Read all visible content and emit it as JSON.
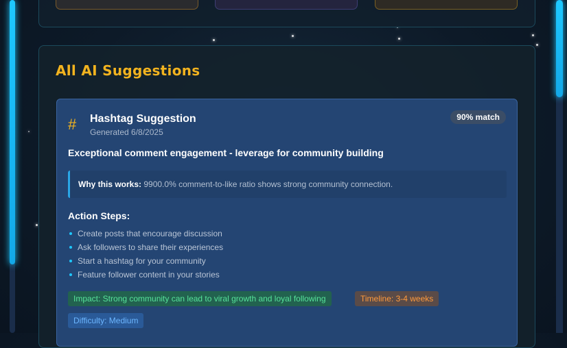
{
  "section": {
    "title": "All AI Suggestions"
  },
  "suggestion": {
    "icon": "hash-icon",
    "icon_glyph": "#",
    "title": "Hashtag Suggestion",
    "generated": "Generated 6/8/2025",
    "match": "90% match",
    "headline": "Exceptional comment engagement - leverage for community building",
    "why_label": "Why this works:",
    "why_text": "9900.0% comment-to-like ratio shows strong community connection.",
    "steps_title": "Action Steps:",
    "steps": [
      "Create posts that encourage discussion",
      "Ask followers to share their experiences",
      "Start a hashtag for your community",
      "Feature follower content in your stories"
    ],
    "impact": "Impact: Strong community can lead to viral growth and loyal following",
    "timeline": "Timeline: 3-4 weeks",
    "difficulty": "Difficulty: Medium"
  },
  "colors": {
    "accent_gold": "#f2b31f",
    "accent_cyan": "#1ec8ff",
    "card_bg": "#244573"
  }
}
